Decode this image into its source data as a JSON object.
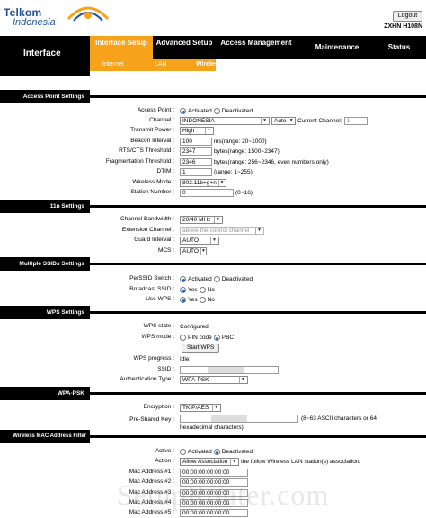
{
  "header": {
    "logo_line1": "Telkom",
    "logo_line2": "Indonesia",
    "logout_label": "Logout",
    "model": "ZXHN H108N"
  },
  "nav": {
    "left_title": "Interface",
    "tabs": [
      {
        "label": "Interface Setup",
        "active": true
      },
      {
        "label": "Advanced Setup",
        "active": false
      },
      {
        "label": "Access Management",
        "active": false
      },
      {
        "label": "Maintenance",
        "active": false
      },
      {
        "label": "Status",
        "active": false
      }
    ],
    "subtabs": [
      {
        "label": "Internet",
        "active": false
      },
      {
        "label": "LAN",
        "active": false
      },
      {
        "label": "Wireless",
        "active": true
      }
    ]
  },
  "ap": {
    "section": "Access Point Settings",
    "access_point": {
      "label": "Access Point :",
      "on": "Activated",
      "off": "Deactivated"
    },
    "channel": {
      "label": "Channel :",
      "value": "INDONESIA",
      "auto": "Auto",
      "current_label": "Current Channel:",
      "current_value": "1"
    },
    "tx_power": {
      "label": "Transmit Power :",
      "value": "High"
    },
    "beacon": {
      "label": "Beacon Interval :",
      "value": "100",
      "hint": "ms(range: 20~1000)"
    },
    "rts": {
      "label": "RTS/CTS Threshold :",
      "value": "2347",
      "hint": "bytes(range: 1500~2347)"
    },
    "frag": {
      "label": "Fragmentation Threshold :",
      "value": "2346",
      "hint": "bytes(range: 256~2346, even numbers only)"
    },
    "dtim": {
      "label": "DTIM :",
      "value": "1",
      "hint": "(range: 1~255)"
    },
    "mode": {
      "label": "Wireless Mode :",
      "value": "802.11b+g+n"
    },
    "station": {
      "label": "Station Number :",
      "value": "0",
      "hint": "(0~16)"
    }
  },
  "n11": {
    "section": "11n Settings",
    "bandwidth": {
      "label": "Channel Bandwidth :",
      "value": "20/40 MHz"
    },
    "ext_channel": {
      "label": "Extension Channel :",
      "value": "above the control channel"
    },
    "guard": {
      "label": "Guard Interval :",
      "value": "AUTO"
    },
    "mcs": {
      "label": "MCS :",
      "value": "AUTO"
    }
  },
  "ssid": {
    "section": "Multiple SSIDs Settings",
    "perssid": {
      "label": "PerSSID Switch :",
      "on": "Activated",
      "off": "Deactivated"
    },
    "broadcast": {
      "label": "Broadcast SSID :",
      "yes": "Yes",
      "no": "No"
    },
    "use_wps": {
      "label": "Use WPS :",
      "yes": "Yes",
      "no": "No"
    }
  },
  "wps": {
    "section": "WPS Settings",
    "state": {
      "label": "WPS state :",
      "value": "Configured"
    },
    "mode": {
      "label": "WPS mode :",
      "pin": "PIN code",
      "pbc": "PBC"
    },
    "start_label": "Start WPS",
    "progress": {
      "label": "WPS progress :",
      "value": "Idle"
    },
    "ssid": {
      "label": "SSID :"
    },
    "auth": {
      "label": "Authentication Type :",
      "value": "WPA-PSK"
    }
  },
  "wpa": {
    "section": "WPA-PSK",
    "encryption": {
      "label": "Encryption :",
      "value": "TKIP/AES"
    },
    "psk": {
      "label": "Pre-Shared Key :",
      "hint1": "(8~63 ASCII characters or 64",
      "hint2": "hexadecimal characters)"
    }
  },
  "mac": {
    "section": "Wireless MAC Address Filter",
    "active": {
      "label": "Active :",
      "on": "Activated",
      "off": "Deactivated"
    },
    "action": {
      "label": "Action :",
      "value": "Allow Association",
      "suffix": "the follow Wireless LAN station(s) association."
    },
    "addresses": [
      {
        "label": "Mac Address #1 :",
        "value": "00:00:00:00:00:00"
      },
      {
        "label": "Mac Address #2 :",
        "value": "00:00:00:00:00:00"
      },
      {
        "label": "Mac Address #3 :",
        "value": "00:00:00:00:00:00"
      },
      {
        "label": "Mac Address #4 :",
        "value": "00:00:00:00:00:00"
      },
      {
        "label": "Mac Address #5 :",
        "value": "00:00:00:00:00:00"
      }
    ]
  },
  "watermark": "SetupRouter.com"
}
